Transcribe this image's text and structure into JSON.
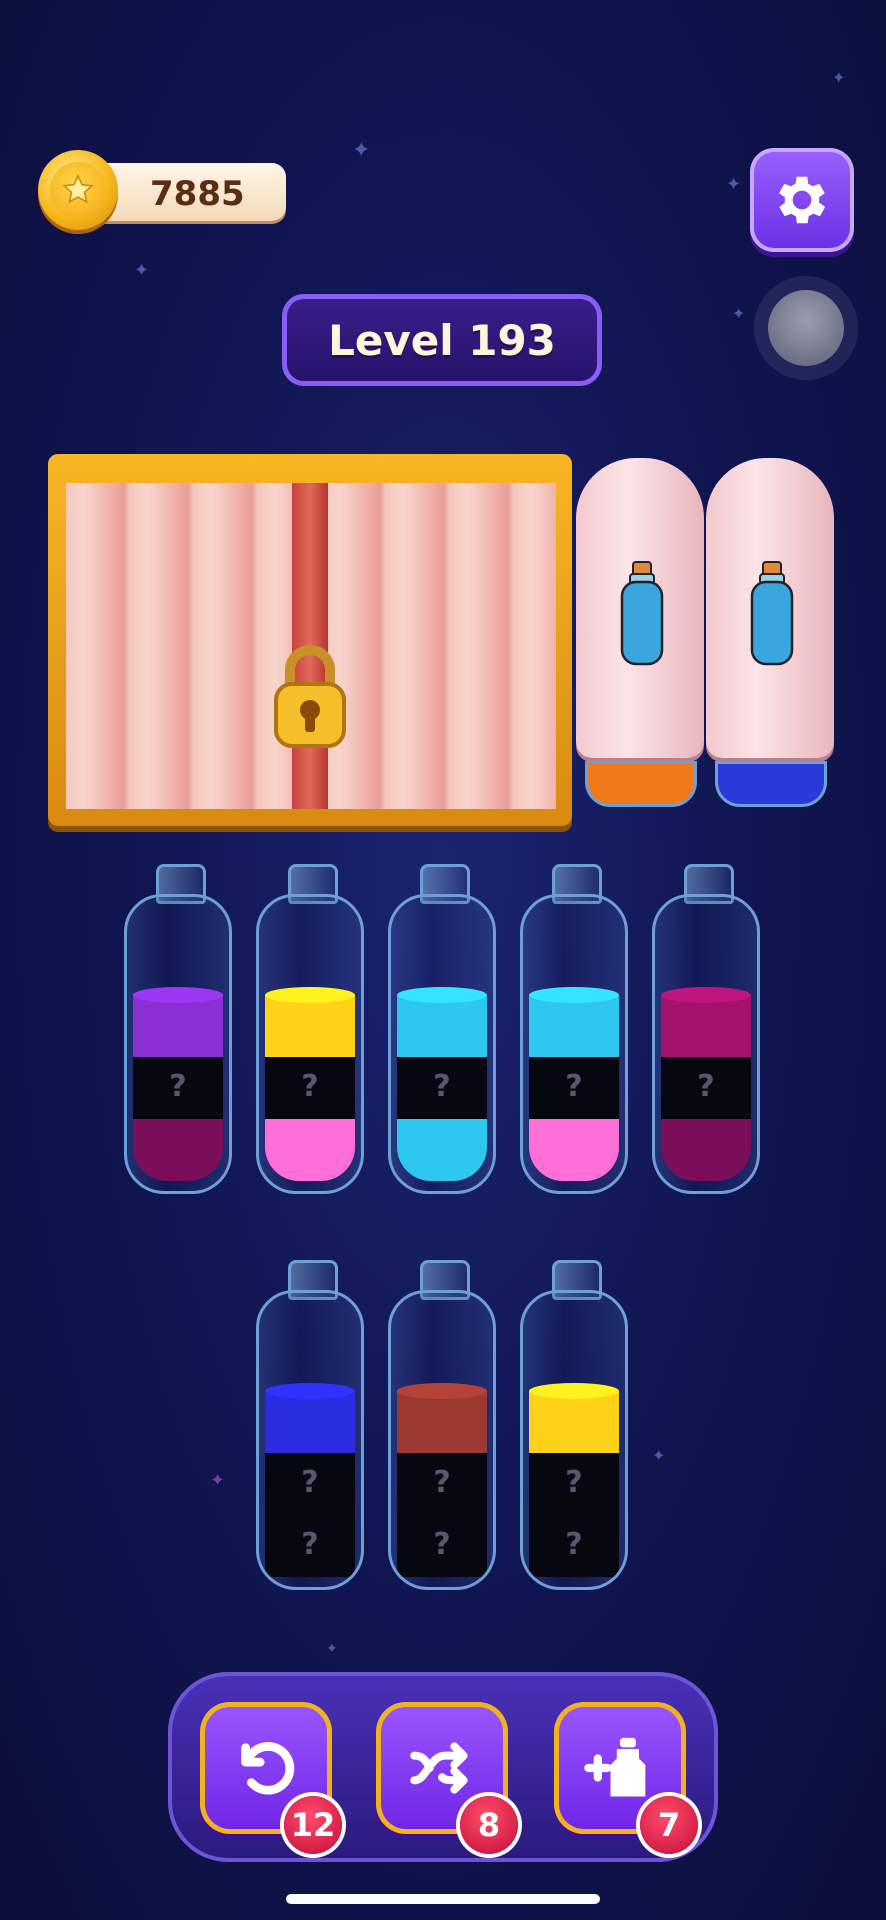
{
  "header": {
    "coins": "7885",
    "level_label": "Level 193"
  },
  "locked_panel": {
    "icon": "padlock-icon"
  },
  "covered_bottles": [
    {
      "base_color": "#f07a1a"
    },
    {
      "base_color": "#2a3ad8"
    }
  ],
  "bottles_row1": [
    {
      "layers": [
        {
          "color": "#8a2fd4"
        },
        {
          "hidden": true,
          "label": "?"
        },
        {
          "color": "#7a0e5a"
        }
      ]
    },
    {
      "layers": [
        {
          "color": "#ffd21a"
        },
        {
          "hidden": true,
          "label": "?"
        },
        {
          "color": "#ff6fd8"
        }
      ]
    },
    {
      "layers": [
        {
          "color": "#2ec7ef"
        },
        {
          "hidden": true,
          "label": "?"
        },
        {
          "color": "#2ec7ef"
        }
      ]
    },
    {
      "layers": [
        {
          "color": "#2ec7ef"
        },
        {
          "hidden": true,
          "label": "?"
        },
        {
          "color": "#ff6fd8"
        }
      ]
    },
    {
      "layers": [
        {
          "color": "#a5126e"
        },
        {
          "hidden": true,
          "label": "?"
        },
        {
          "color": "#7a0e5a"
        }
      ]
    }
  ],
  "bottles_row2": [
    {
      "layers": [
        {
          "color": "#2a2ce0"
        },
        {
          "hidden": true,
          "label": "?"
        },
        {
          "hidden": true,
          "label": "?"
        }
      ]
    },
    {
      "layers": [
        {
          "color": "#9c3a30"
        },
        {
          "hidden": true,
          "label": "?"
        },
        {
          "hidden": true,
          "label": "?"
        }
      ]
    },
    {
      "layers": [
        {
          "color": "#ffd21a"
        },
        {
          "hidden": true,
          "label": "?"
        },
        {
          "hidden": true,
          "label": "?"
        }
      ]
    }
  ],
  "tools": {
    "undo_count": "12",
    "shuffle_count": "8",
    "add_bottle_count": "7"
  }
}
